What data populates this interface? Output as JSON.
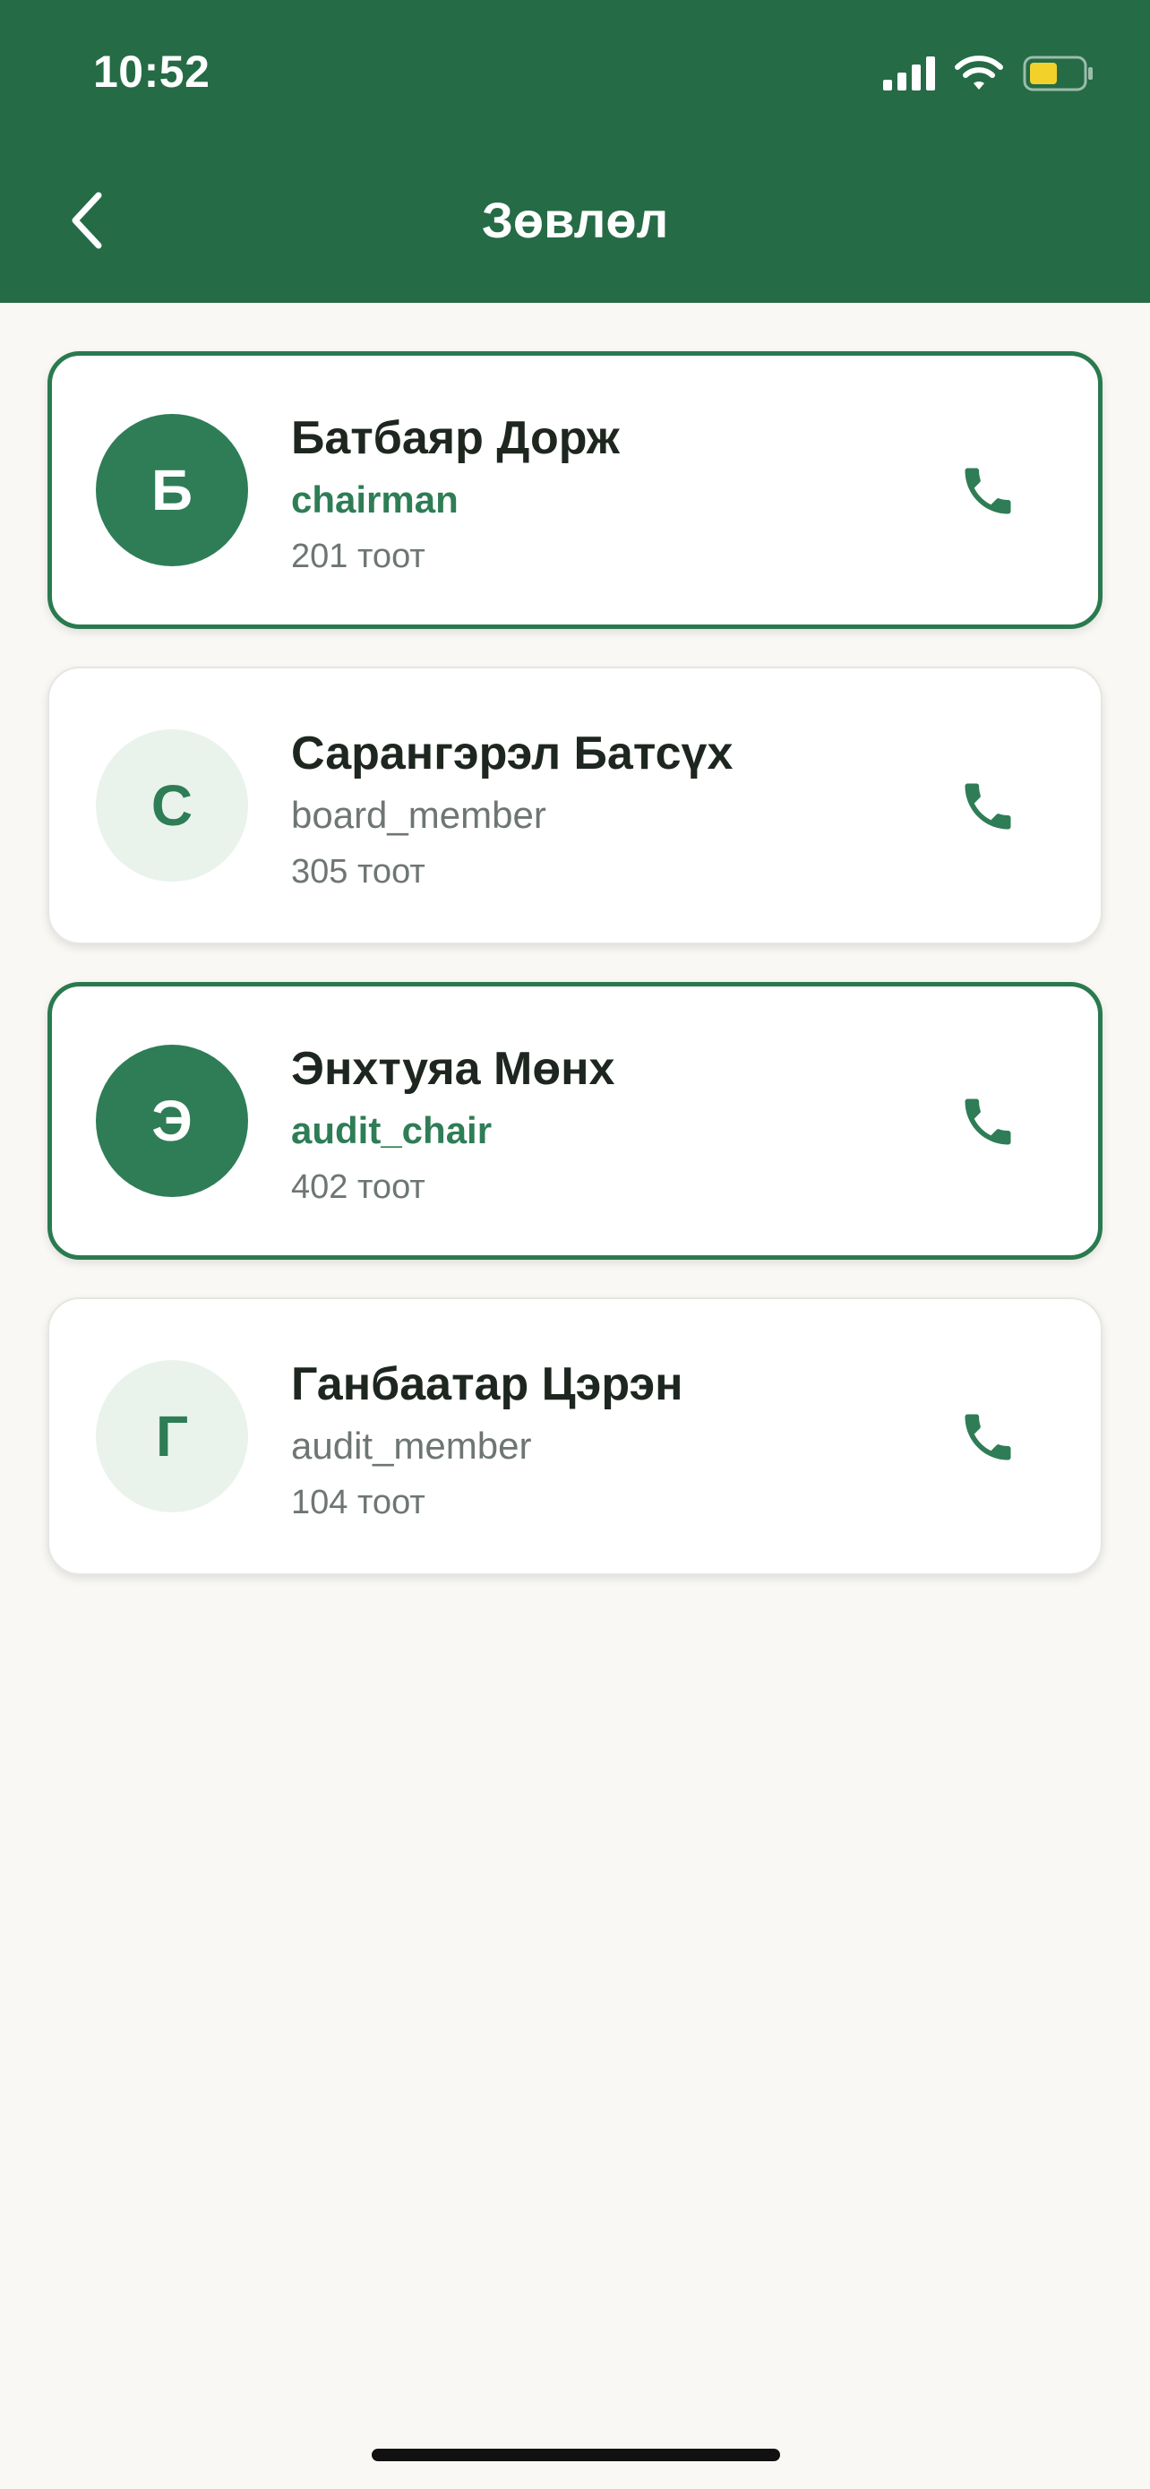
{
  "status_bar": {
    "time": "10:52",
    "icons": [
      "signal-icon",
      "wifi-icon",
      "battery-icon"
    ],
    "battery_color": "#F2D12B"
  },
  "header": {
    "title": "Зөвлөл",
    "back_icon": "chevron-left-icon",
    "background_color": "#256B46"
  },
  "members": [
    {
      "initial": "Б",
      "name": "Батбаяр Дорж",
      "role": "chairman",
      "unit": "201 тоот",
      "highlighted": true
    },
    {
      "initial": "С",
      "name": "Сарангэрэл Батсүх",
      "role": "board_member",
      "unit": "305 тоот",
      "highlighted": false
    },
    {
      "initial": "Э",
      "name": "Энхтуяа Мөнх",
      "role": "audit_chair",
      "unit": "402 тоот",
      "highlighted": true
    },
    {
      "initial": "Г",
      "name": "Ганбаатар Цэрэн",
      "role": "audit_member",
      "unit": "104 тоот",
      "highlighted": false
    }
  ],
  "colors": {
    "accent": "#2E7D56",
    "card_border_highlight": "#2A7A4F",
    "avatar_light_bg": "#E9F3EC",
    "page_background": "#F9F8F4"
  },
  "call_icon": "phone-icon"
}
